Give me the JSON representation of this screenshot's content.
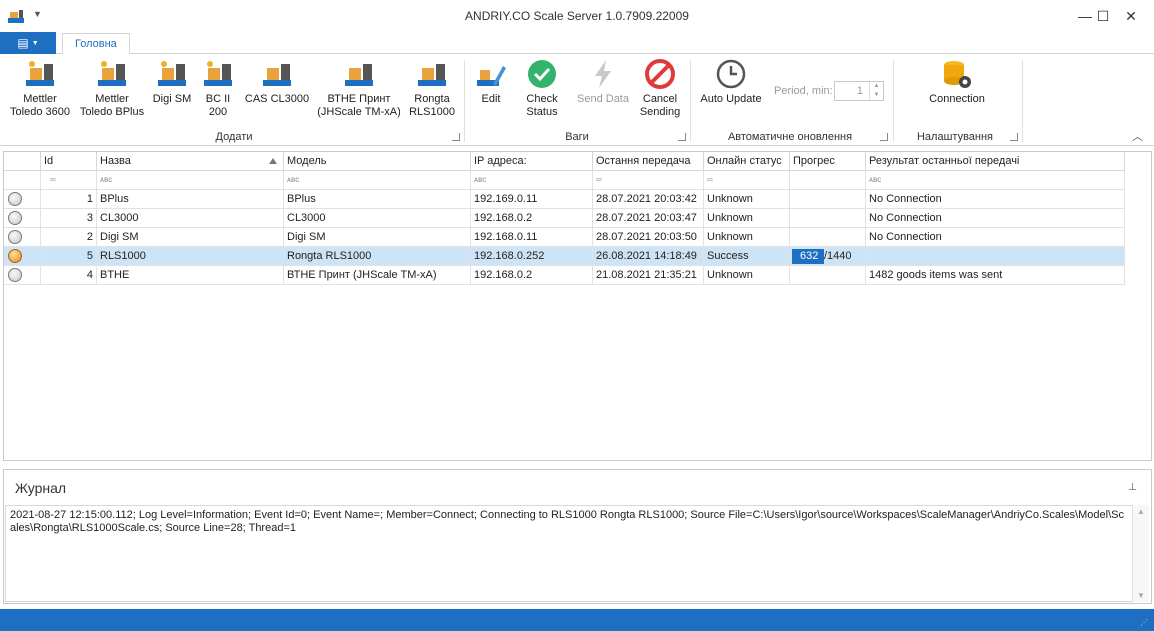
{
  "window": {
    "title": "ANDRIY.CO Scale Server 1.0.7909.22009",
    "minimize": "—",
    "maximize": "☐",
    "close": "✕"
  },
  "ribbon": {
    "file_glyph": "▤",
    "tab_main": "Головна",
    "groups": {
      "add": "Додати",
      "scales": "Ваги",
      "auto": "Автоматичне оновлення",
      "settings": "Налаштування"
    },
    "buttons": {
      "mettler3600": "Mettler Toledo 3600",
      "mettler_bplus": "Mettler Toledo BPlus",
      "digi_sm": "Digi SM",
      "bc2": "BC II 200",
      "cas": "CAS CL3000",
      "bthe": "ВТНЕ Принт (JHScale TM-xA)",
      "rongta": "Rongta RLS1000",
      "edit": "Edit",
      "check": "Check Status",
      "send": "Send Data",
      "cancel": "Cancel Sending",
      "auto_update": "Auto Update",
      "connection": "Connection"
    },
    "period_label": "Period, min:",
    "period_value": "1"
  },
  "grid": {
    "columns": [
      "Id",
      "Назва",
      "Модель",
      "IP адреса:",
      "Остання передача",
      "Онлайн статус",
      "Прогрес",
      "Результат останньої передачі"
    ],
    "filter_icons": {
      "eq": "═",
      "abc": "ᴀʙc"
    },
    "rows": [
      {
        "id": "1",
        "name": "BPlus",
        "model": "BPlus",
        "ip": "192.169.0.11",
        "last": "28.07.2021 20:03:42",
        "status": "Unknown",
        "progress": "",
        "progress_total": "",
        "result": "No Connection",
        "selected": false
      },
      {
        "id": "3",
        "name": "CL3000",
        "model": "CL3000",
        "ip": "192.168.0.2",
        "last": "28.07.2021 20:03:47",
        "status": "Unknown",
        "progress": "",
        "progress_total": "",
        "result": "No Connection",
        "selected": false
      },
      {
        "id": "2",
        "name": "Digi SM",
        "model": "Digi SM",
        "ip": "192.168.0.11",
        "last": "28.07.2021 20:03:50",
        "status": "Unknown",
        "progress": "",
        "progress_total": "",
        "result": "No Connection",
        "selected": false
      },
      {
        "id": "5",
        "name": "RLS1000",
        "model": "Rongta RLS1000",
        "ip": "192.168.0.252",
        "last": "26.08.2021 14:18:49",
        "status": "Success",
        "progress": "632",
        "progress_total": "/1440",
        "progress_fraction": 0.439,
        "result": "",
        "selected": true
      },
      {
        "id": "4",
        "name": "BTHE",
        "model": "ВТНЕ Принт (JHScale TM-xA)",
        "ip": "192.168.0.2",
        "last": "21.08.2021 21:35:21",
        "status": "Unknown",
        "progress": "",
        "progress_total": "",
        "result": "1482 goods items was sent",
        "selected": false
      }
    ]
  },
  "journal": {
    "title": "Журнал",
    "pin_glyph": "📌",
    "log": "2021-08-27 12:15:00.112; Log Level=Information; Event Id=0; Event Name=; Member=Connect; Connecting to RLS1000 Rongta RLS1000; Source File=C:\\Users\\Igor\\source\\Workspaces\\ScaleManager\\AndriyCo.Scales\\Model\\Scales\\Rongta\\RLS1000Scale.cs; Source Line=28; Thread=1"
  },
  "colors": {
    "accent": "#1e6fc2",
    "selected_row": "#cde4f7"
  }
}
